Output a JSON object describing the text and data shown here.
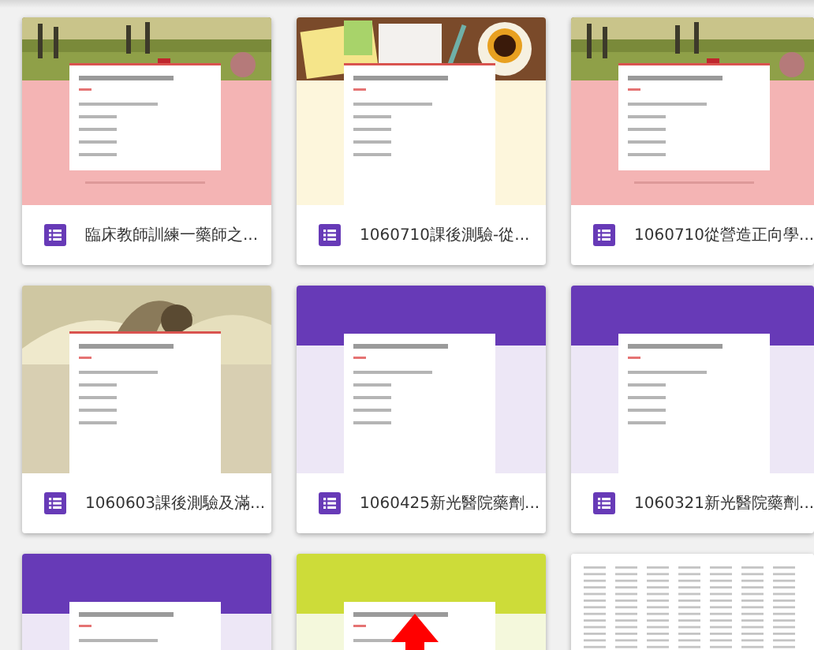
{
  "forms": [
    {
      "title": "臨床教師訓練一藥師之...",
      "kind": "park"
    },
    {
      "title": "1060710課後測驗-從...",
      "kind": "desk"
    },
    {
      "title": "1060710從營造正向學...",
      "kind": "park"
    },
    {
      "title": "1060603課後測驗及滿...",
      "kind": "book"
    },
    {
      "title": "1060425新光醫院藥劑...",
      "kind": "purple"
    },
    {
      "title": "1060321新光醫院藥劑...",
      "kind": "purple"
    },
    {
      "kind": "purple"
    },
    {
      "kind": "lime"
    },
    {
      "kind": "sheet"
    }
  ],
  "annotations": [
    {
      "kind": "arrow"
    }
  ]
}
